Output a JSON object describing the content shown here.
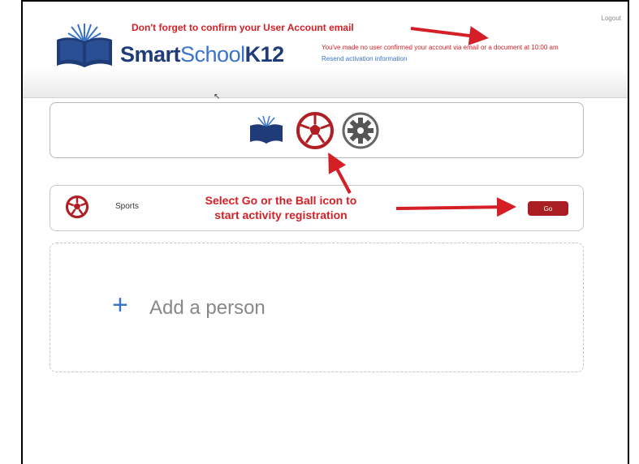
{
  "header": {
    "brand_part1": "Smart",
    "brand_part2": "School",
    "brand_part3": "K12",
    "logout_label": "Logout",
    "notice_line1": "You've made no user confirmed your account via email or a document at 10:00 am",
    "notice_line2": "Resend activation information"
  },
  "annotations": {
    "email_reminder": "Don't forget to confirm your User Account email",
    "select_line1": "Select Go or the Ball icon to",
    "select_line2": "start activity registration"
  },
  "icon_bar": {
    "icons": [
      "book-logo-icon",
      "soccer-ball-icon",
      "gear-icon"
    ]
  },
  "activity": {
    "label": "Sports",
    "go_label": "Go"
  },
  "add_person": {
    "plus": "+",
    "label": "Add a person"
  },
  "colors": {
    "annotation_red": "#d41f26",
    "brand_dark_blue": "#1f3c78",
    "brand_light_blue": "#3a74c6",
    "go_button": "#a81e22"
  }
}
